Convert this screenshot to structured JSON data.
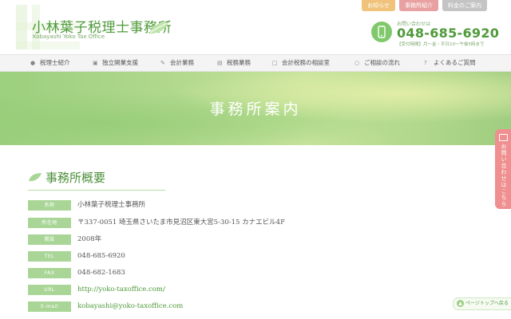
{
  "header": {
    "logo_title": "小林葉子税理士事務所",
    "logo_subtitle": "Kobayashi Yoko Tax Office",
    "top_buttons": [
      "お知らせ",
      "事務所紹介",
      "料金のご案内"
    ],
    "phone": {
      "caption": "お問い合わせは",
      "number": "048-685-6920",
      "hours": "【受付時間】月～金・平日10～午後5時まで"
    }
  },
  "nav": {
    "items": [
      {
        "label": "税理士紹介",
        "icon": "user-icon"
      },
      {
        "label": "独立開業支援",
        "icon": "camera-icon"
      },
      {
        "label": "会計業務",
        "icon": "pencil-icon"
      },
      {
        "label": "税務業務",
        "icon": "document-icon"
      },
      {
        "label": "会計税務の相談室",
        "icon": "chat-icon"
      },
      {
        "label": "ご相談の流れ",
        "icon": "clock-icon"
      },
      {
        "label": "よくあるご質問",
        "icon": "question-icon"
      }
    ]
  },
  "hero": {
    "title": "事務所案内"
  },
  "side_tab": {
    "label": "お問い合わせはこちら"
  },
  "section": {
    "title": "事務所概要"
  },
  "overview": {
    "rows": [
      {
        "label": "名称",
        "value": "小林葉子税理士事務所"
      },
      {
        "label": "所在地",
        "value": "〒337-0051 埼玉県さいたま市見沼区東大宮5-30-15 カナエビル4F"
      },
      {
        "label": "開設",
        "value": "2008年"
      },
      {
        "label": "TEL",
        "value": "048-685-6920"
      },
      {
        "label": "FAX",
        "value": "048-682-1683"
      },
      {
        "label": "URL",
        "value": "http://yoko-taxoffice.com/"
      },
      {
        "label": "E-mail",
        "value": "kobayashi@yoko-taxoffice.com"
      }
    ]
  },
  "page_top": {
    "label": "ページトップへ戻る"
  },
  "colors": {
    "brand_green": "#4f9a3a",
    "label_green": "#a9d697",
    "accent_pink": "#ef8f8f"
  }
}
